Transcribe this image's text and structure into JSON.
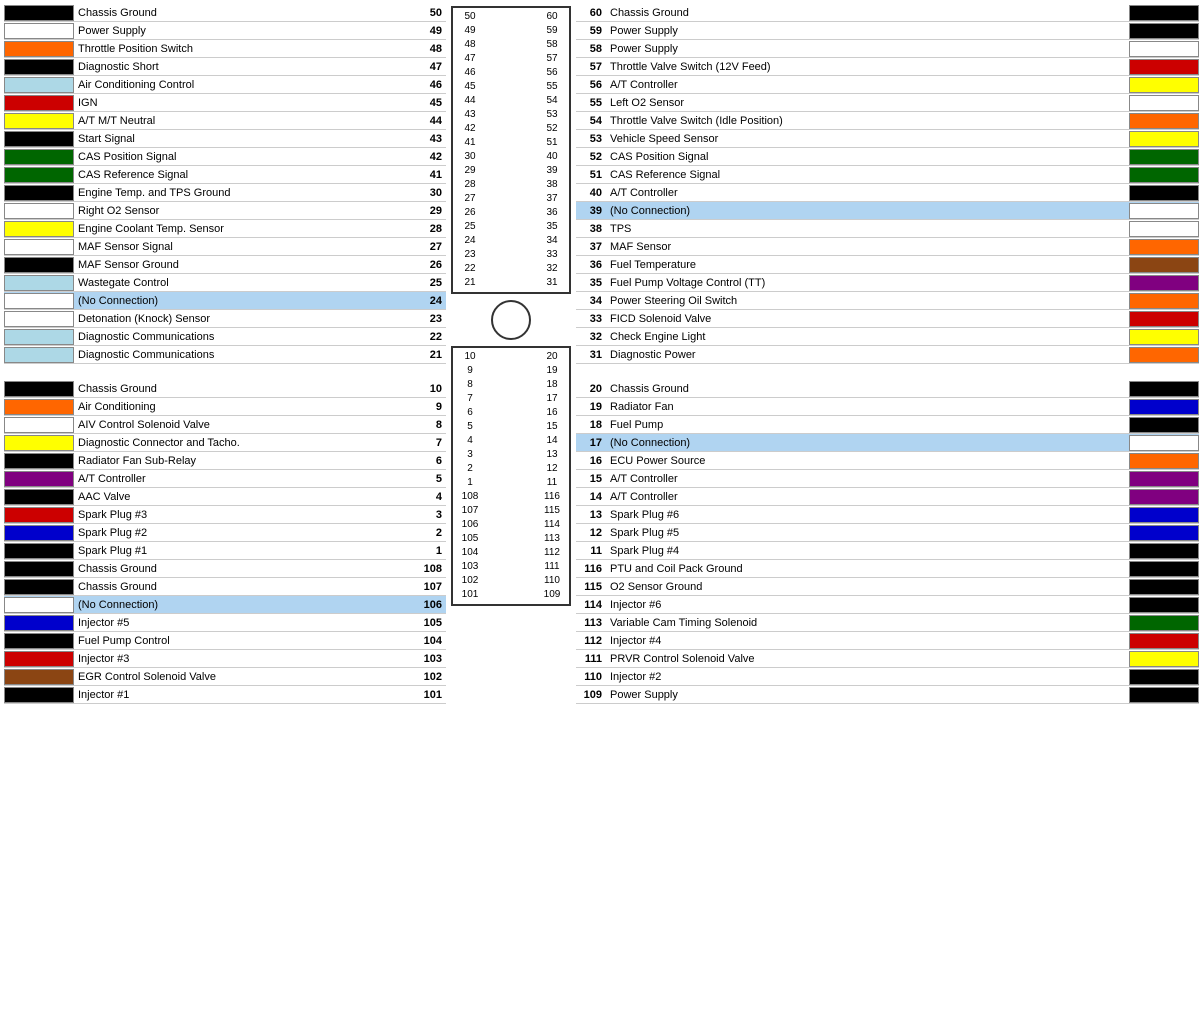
{
  "left": {
    "rows_top": [
      {
        "num": 50,
        "label": "Chassis Ground",
        "color": "#000000",
        "no_conn": false
      },
      {
        "num": 49,
        "label": "Power Supply",
        "color": null,
        "no_conn": false
      },
      {
        "num": 48,
        "label": "Throttle Position Switch",
        "color": "#ff6600",
        "no_conn": false
      },
      {
        "num": 47,
        "label": "Diagnostic Short",
        "color": "#000000",
        "no_conn": false
      },
      {
        "num": 46,
        "label": "Air Conditioning Control",
        "color": "#add8e6",
        "no_conn": false
      },
      {
        "num": 45,
        "label": "IGN",
        "color": "#cc0000",
        "no_conn": false
      },
      {
        "num": 44,
        "label": "A/T M/T Neutral",
        "color": "#ffff00",
        "no_conn": false
      },
      {
        "num": 43,
        "label": "Start Signal",
        "color": "#000000",
        "no_conn": false
      },
      {
        "num": 42,
        "label": "CAS Position Signal",
        "color": "#006600",
        "no_conn": false
      },
      {
        "num": 41,
        "label": "CAS Reference Signal",
        "color": "#006600",
        "no_conn": false
      },
      {
        "num": 30,
        "label": "Engine Temp. and TPS Ground",
        "color": "#000000",
        "no_conn": false
      },
      {
        "num": 29,
        "label": "Right O2 Sensor",
        "color": null,
        "no_conn": false
      },
      {
        "num": 28,
        "label": "Engine Coolant Temp. Sensor",
        "color": "#ffff00",
        "no_conn": false
      },
      {
        "num": 27,
        "label": "MAF Sensor Signal",
        "color": null,
        "no_conn": false
      },
      {
        "num": 26,
        "label": "MAF Sensor Ground",
        "color": "#000000",
        "no_conn": false
      },
      {
        "num": 25,
        "label": "Wastegate Control",
        "color": "#add8e6",
        "no_conn": false
      },
      {
        "num": 24,
        "label": "(No Connection)",
        "color": null,
        "no_conn": true
      },
      {
        "num": 23,
        "label": "Detonation (Knock) Sensor",
        "color": null,
        "no_conn": false
      },
      {
        "num": 22,
        "label": "Diagnostic Communications",
        "color": "#add8e6",
        "no_conn": false
      },
      {
        "num": 21,
        "label": "Diagnostic Communications",
        "color": "#add8e6",
        "no_conn": false
      }
    ],
    "rows_bottom": [
      {
        "num": 10,
        "label": "Chassis Ground",
        "color": "#000000",
        "no_conn": false
      },
      {
        "num": 9,
        "label": "Air Conditioning",
        "color": "#ff6600",
        "no_conn": false
      },
      {
        "num": 8,
        "label": "AIV Control Solenoid Valve",
        "color": null,
        "no_conn": false
      },
      {
        "num": 7,
        "label": "Diagnostic Connector and Tacho.",
        "color": "#ffff00",
        "no_conn": false
      },
      {
        "num": 6,
        "label": "Radiator Fan Sub-Relay",
        "color": "#000000",
        "no_conn": false
      },
      {
        "num": 5,
        "label": "A/T Controller",
        "color": "#800080",
        "no_conn": false
      },
      {
        "num": 4,
        "label": "AAC Valve",
        "color": "#000000",
        "no_conn": false
      },
      {
        "num": 3,
        "label": "Spark Plug #3",
        "color": "#cc0000",
        "no_conn": false
      },
      {
        "num": 2,
        "label": "Spark Plug #2",
        "color": "#0000cc",
        "no_conn": false
      },
      {
        "num": 1,
        "label": "Spark Plug #1",
        "color": "#000000",
        "no_conn": false
      },
      {
        "num": 108,
        "label": "Chassis Ground",
        "color": "#000000",
        "no_conn": false
      },
      {
        "num": 107,
        "label": "Chassis Ground",
        "color": "#000000",
        "no_conn": false
      },
      {
        "num": 106,
        "label": "(No Connection)",
        "color": null,
        "no_conn": true
      },
      {
        "num": 105,
        "label": "Injector #5",
        "color": "#0000cc",
        "no_conn": false
      },
      {
        "num": 104,
        "label": "Fuel Pump Control",
        "color": "#000000",
        "no_conn": false
      },
      {
        "num": 103,
        "label": "Injector #3",
        "color": "#cc0000",
        "no_conn": false
      },
      {
        "num": 102,
        "label": "EGR Control Solenoid Valve",
        "color": "#8B4513",
        "no_conn": false
      },
      {
        "num": 101,
        "label": "Injector #1",
        "color": "#000000",
        "no_conn": false
      }
    ]
  },
  "right": {
    "rows_top": [
      {
        "num": 60,
        "label": "Chassis Ground",
        "color": "#000000",
        "no_conn": false
      },
      {
        "num": 59,
        "label": "Power Supply",
        "color": "#000000",
        "no_conn": false
      },
      {
        "num": 58,
        "label": "Power Supply",
        "color": null,
        "no_conn": false
      },
      {
        "num": 57,
        "label": "Throttle Valve Switch (12V Feed)",
        "color": "#cc0000",
        "no_conn": false
      },
      {
        "num": 56,
        "label": "A/T Controller",
        "color": "#ffff00",
        "no_conn": false
      },
      {
        "num": 55,
        "label": "Left O2 Sensor",
        "color": null,
        "no_conn": false
      },
      {
        "num": 54,
        "label": "Throttle Valve Switch (Idle Position)",
        "color": "#ff6600",
        "no_conn": false
      },
      {
        "num": 53,
        "label": "Vehicle Speed Sensor",
        "color": "#ffff00",
        "no_conn": false
      },
      {
        "num": 52,
        "label": "CAS Position Signal",
        "color": "#006600",
        "no_conn": false
      },
      {
        "num": 51,
        "label": "CAS Reference Signal",
        "color": "#006600",
        "no_conn": false
      },
      {
        "num": 40,
        "label": "A/T Controller",
        "color": "#000000",
        "no_conn": false
      },
      {
        "num": 39,
        "label": "(No Connection)",
        "color": null,
        "no_conn": true
      },
      {
        "num": 38,
        "label": "TPS",
        "color": null,
        "no_conn": false
      },
      {
        "num": 37,
        "label": "MAF Sensor",
        "color": "#ff6600",
        "no_conn": false
      },
      {
        "num": 36,
        "label": "Fuel Temperature",
        "color": "#8B4513",
        "no_conn": false
      },
      {
        "num": 35,
        "label": "Fuel Pump Voltage Control (TT)",
        "color": "#800080",
        "no_conn": false
      },
      {
        "num": 34,
        "label": "Power Steering Oil Switch",
        "color": "#ff6600",
        "no_conn": false
      },
      {
        "num": 33,
        "label": "FICD Solenoid Valve",
        "color": "#cc0000",
        "no_conn": false
      },
      {
        "num": 32,
        "label": "Check Engine Light",
        "color": "#ffff00",
        "no_conn": false
      },
      {
        "num": 31,
        "label": "Diagnostic Power",
        "color": "#ff6600",
        "no_conn": false
      }
    ],
    "rows_bottom": [
      {
        "num": 20,
        "label": "Chassis Ground",
        "color": "#000000",
        "no_conn": false
      },
      {
        "num": 19,
        "label": "Radiator Fan",
        "color": "#0000cc",
        "no_conn": false
      },
      {
        "num": 18,
        "label": "Fuel Pump",
        "color": "#000000",
        "no_conn": false
      },
      {
        "num": 17,
        "label": "(No Connection)",
        "color": null,
        "no_conn": true
      },
      {
        "num": 16,
        "label": "ECU Power Source",
        "color": "#ff6600",
        "no_conn": false
      },
      {
        "num": 15,
        "label": "A/T Controller",
        "color": "#800080",
        "no_conn": false
      },
      {
        "num": 14,
        "label": "A/T Controller",
        "color": "#800080",
        "no_conn": false
      },
      {
        "num": 13,
        "label": "Spark Plug #6",
        "color": "#0000cc",
        "no_conn": false
      },
      {
        "num": 12,
        "label": "Spark Plug #5",
        "color": "#0000cc",
        "no_conn": false
      },
      {
        "num": 11,
        "label": "Spark Plug #4",
        "color": "#000000",
        "no_conn": false
      },
      {
        "num": 116,
        "label": "PTU and Coil Pack Ground",
        "color": "#000000",
        "no_conn": false
      },
      {
        "num": 115,
        "label": "O2 Sensor Ground",
        "color": "#000000",
        "no_conn": false
      },
      {
        "num": 114,
        "label": "Injector #6",
        "color": "#000000",
        "no_conn": false
      },
      {
        "num": 113,
        "label": "Variable Cam Timing Solenoid",
        "color": "#006600",
        "no_conn": false
      },
      {
        "num": 112,
        "label": "Injector #4",
        "color": "#cc0000",
        "no_conn": false
      },
      {
        "num": 111,
        "label": "PRVR Control Solenoid Valve",
        "color": "#ffff00",
        "no_conn": false
      },
      {
        "num": 110,
        "label": "Injector #2",
        "color": "#000000",
        "no_conn": false
      },
      {
        "num": 109,
        "label": "Power Supply",
        "color": "#000000",
        "no_conn": false
      }
    ]
  },
  "connector": {
    "top_pairs": [
      [
        50,
        60
      ],
      [
        49,
        59
      ],
      [
        48,
        58
      ],
      [
        47,
        57
      ],
      [
        46,
        56
      ],
      [
        45,
        55
      ],
      [
        44,
        54
      ],
      [
        43,
        53
      ],
      [
        42,
        52
      ],
      [
        41,
        51
      ],
      [
        30,
        40
      ],
      [
        29,
        39
      ],
      [
        28,
        38
      ],
      [
        27,
        37
      ],
      [
        26,
        36
      ],
      [
        25,
        35
      ],
      [
        24,
        34
      ],
      [
        23,
        33
      ],
      [
        22,
        32
      ],
      [
        21,
        31
      ]
    ],
    "bottom_pairs": [
      [
        10,
        20
      ],
      [
        9,
        19
      ],
      [
        8,
        18
      ],
      [
        7,
        17
      ],
      [
        6,
        16
      ],
      [
        5,
        15
      ],
      [
        4,
        14
      ],
      [
        3,
        13
      ],
      [
        2,
        12
      ],
      [
        1,
        11
      ],
      [
        108,
        116
      ],
      [
        107,
        115
      ],
      [
        106,
        114
      ],
      [
        105,
        113
      ],
      [
        104,
        112
      ],
      [
        103,
        111
      ],
      [
        102,
        110
      ],
      [
        101,
        109
      ]
    ]
  }
}
